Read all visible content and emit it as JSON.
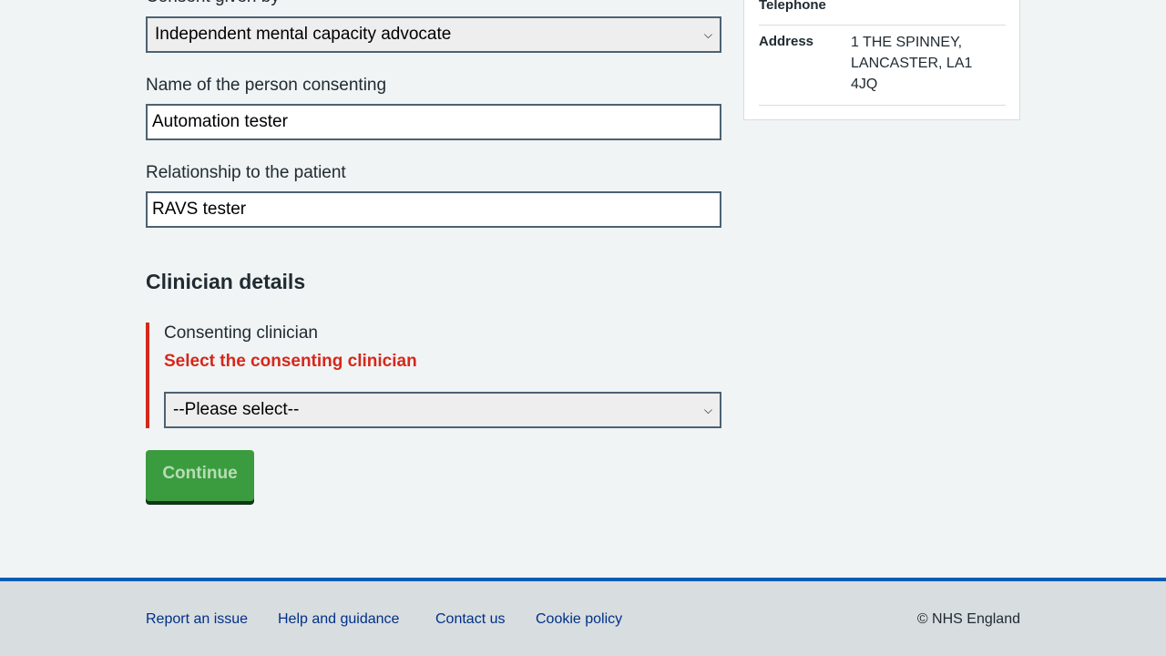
{
  "form": {
    "consent_given_by_label": "Consent given by",
    "consent_given_by_value": "Independent mental capacity advocate",
    "name_label": "Name of the person consenting",
    "name_value": "Automation tester",
    "relationship_label": "Relationship to the patient",
    "relationship_value": "RAVS tester",
    "clinician_heading": "Clinician details",
    "consenting_clinician_label": "Consenting clinician",
    "consenting_clinician_error": "Select the consenting clinician",
    "consenting_clinician_value": "--Please select--",
    "continue_label": "Continue"
  },
  "patient_panel": {
    "telephone_label": "Telephone",
    "address_label": "Address",
    "address_line1": "1 THE SPINNEY,",
    "address_line2": "LANCASTER, LA1",
    "address_line3": "4JQ"
  },
  "footer": {
    "links": [
      "Report an issue",
      "Help and guidance",
      "Contact us",
      "Cookie policy"
    ],
    "copyright": "© NHS England"
  },
  "colors": {
    "page_bg": "#f0f4f5",
    "error": "#d5281b",
    "button": "#3a9c3e",
    "nhs_blue": "#005eb8",
    "link": "#003087"
  }
}
